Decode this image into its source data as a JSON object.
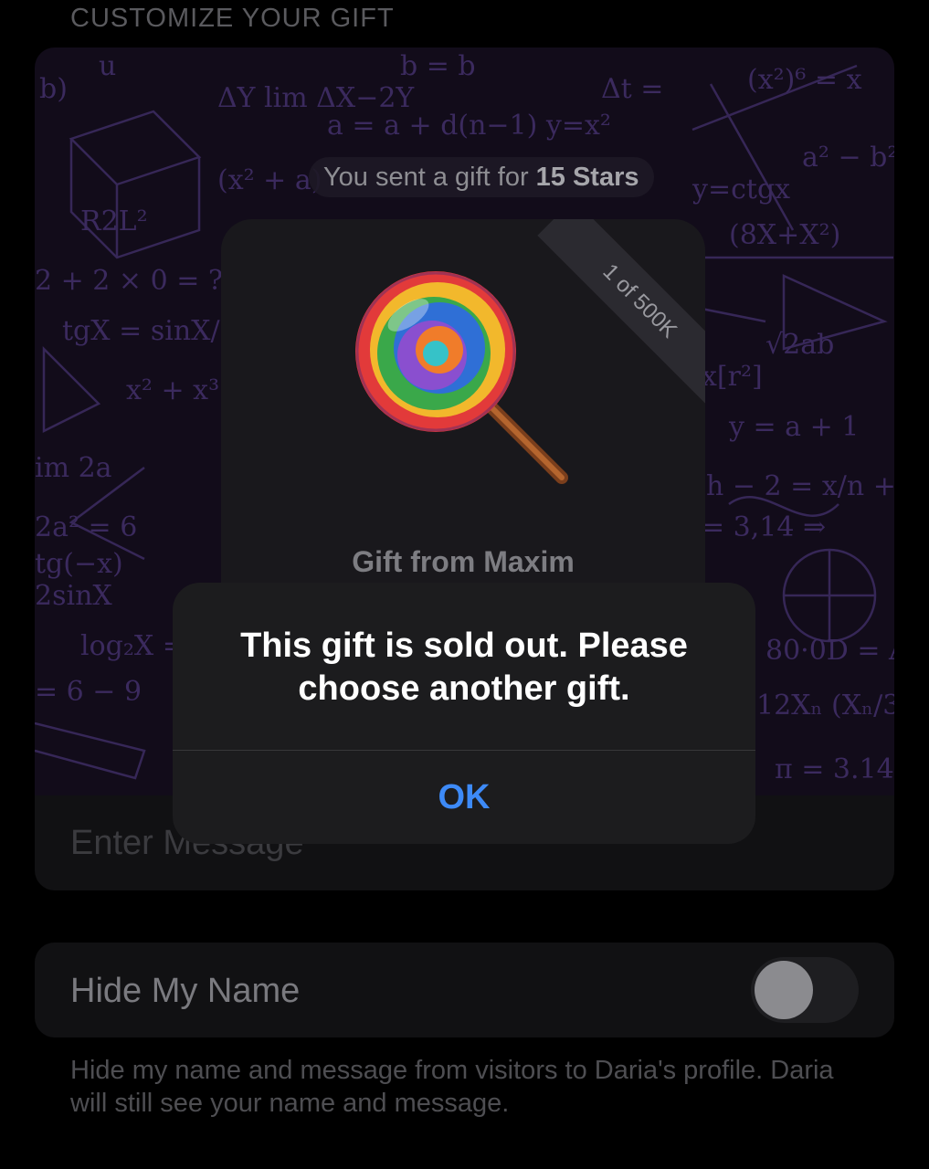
{
  "section_title": "CUSTOMIZE YOUR GIFT",
  "preview": {
    "sent_text": "You sent a gift for",
    "sent_amount": "15 Stars",
    "gift_card": {
      "edition_badge": "1 of 500K",
      "gift_icon": "lollipop-icon",
      "gift_from": "Gift from Maxim"
    }
  },
  "message_field": {
    "placeholder": "Enter Message",
    "value": ""
  },
  "hide_my_name": {
    "label": "Hide My Name",
    "toggle_on": false
  },
  "footnote": "Hide my name and message from visitors to Daria's profile. Daria will still see your name and message.",
  "alert": {
    "message": "This gift is sold out. Please choose another gift.",
    "ok_label": "OK"
  },
  "colors": {
    "background": "#000000",
    "alert_background": "#1c1c1e",
    "accent_blue": "#3d8af7",
    "doodle_purple": "#3b2a5e"
  }
}
